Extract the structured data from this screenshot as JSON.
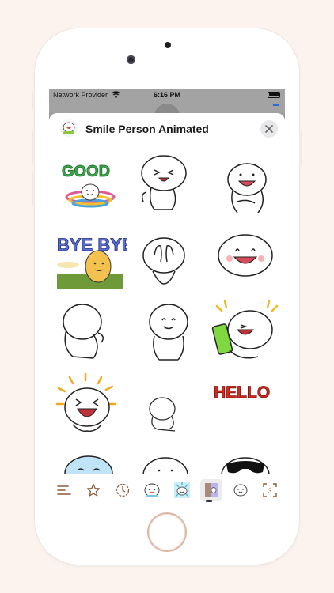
{
  "status_bar": {
    "carrier": "Network Provider",
    "time": "6:16 PM"
  },
  "sheet": {
    "title": "Smile Person Animated",
    "close_icon": "close-icon"
  },
  "stickers": [
    {
      "name": "good-sticker",
      "text": "GOOD"
    },
    {
      "name": "laughing-sticker"
    },
    {
      "name": "open-mouth-smile-sticker"
    },
    {
      "name": "bye-bye-sticker",
      "text": "BYE BYE"
    },
    {
      "name": "hands-over-face-sticker"
    },
    {
      "name": "big-smile-sticker"
    },
    {
      "name": "back-turned-sticker"
    },
    {
      "name": "standing-smile-sticker"
    },
    {
      "name": "phone-laugh-sticker"
    },
    {
      "name": "laugh-burst-sticker"
    },
    {
      "name": "small-sitting-sticker"
    },
    {
      "name": "hello-sticker",
      "text": "HELLO"
    },
    {
      "name": "crying-sticker"
    },
    {
      "name": "peeking-sticker"
    },
    {
      "name": "sunglasses-sticker"
    }
  ],
  "tabs": [
    {
      "name": "menu-icon"
    },
    {
      "name": "star-icon"
    },
    {
      "name": "recent-clock-icon"
    },
    {
      "name": "sticker-pack-icon"
    },
    {
      "name": "sticker-pack-2-icon"
    },
    {
      "name": "smile-person-pack-icon",
      "selected": true
    },
    {
      "name": "sticker-pack-4-icon"
    },
    {
      "name": "expand-icon",
      "badge": "3"
    }
  ],
  "colors": {
    "background": "#fcf3ee",
    "good_green": "#3aa84b",
    "hello_red": "#d42a1f",
    "bye_blue": "#5a6fd6"
  }
}
